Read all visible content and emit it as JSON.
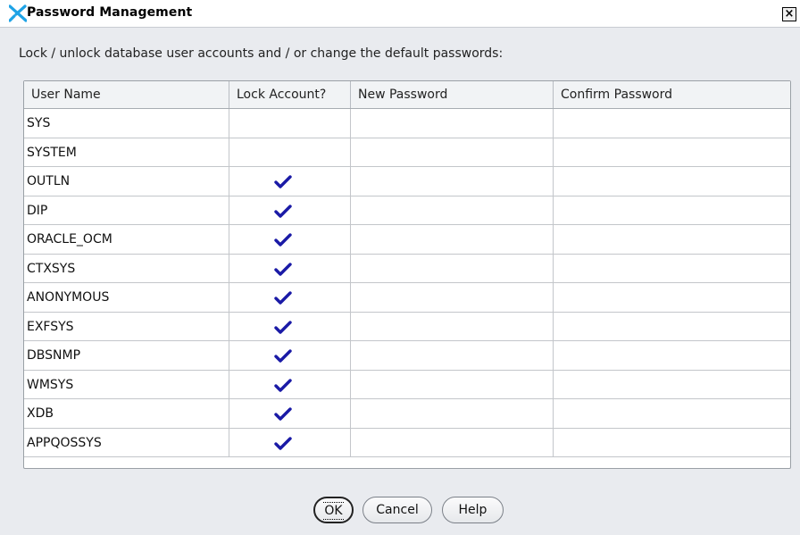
{
  "window": {
    "title": "Password Management",
    "close_symbol": "×",
    "icon": "oracle-x-icon"
  },
  "instructions": "Lock / unlock database user accounts and / or change the default passwords:",
  "table": {
    "columns": [
      "User Name",
      "Lock Account?",
      "New Password",
      "Confirm Password"
    ],
    "rows": [
      {
        "user": "SYS",
        "locked": false,
        "new_password": "",
        "confirm_password": ""
      },
      {
        "user": "SYSTEM",
        "locked": false,
        "new_password": "",
        "confirm_password": ""
      },
      {
        "user": "OUTLN",
        "locked": true,
        "new_password": "",
        "confirm_password": ""
      },
      {
        "user": "DIP",
        "locked": true,
        "new_password": "",
        "confirm_password": ""
      },
      {
        "user": "ORACLE_OCM",
        "locked": true,
        "new_password": "",
        "confirm_password": ""
      },
      {
        "user": "CTXSYS",
        "locked": true,
        "new_password": "",
        "confirm_password": ""
      },
      {
        "user": "ANONYMOUS",
        "locked": true,
        "new_password": "",
        "confirm_password": ""
      },
      {
        "user": "EXFSYS",
        "locked": true,
        "new_password": "",
        "confirm_password": ""
      },
      {
        "user": "DBSNMP",
        "locked": true,
        "new_password": "",
        "confirm_password": ""
      },
      {
        "user": "WMSYS",
        "locked": true,
        "new_password": "",
        "confirm_password": ""
      },
      {
        "user": "XDB",
        "locked": true,
        "new_password": "",
        "confirm_password": ""
      },
      {
        "user": "APPQOSSYS",
        "locked": true,
        "new_password": "",
        "confirm_password": ""
      }
    ]
  },
  "buttons": {
    "ok": "OK",
    "cancel": "Cancel",
    "help": "Help"
  },
  "colors": {
    "checkmark": "#1a1aa6",
    "dialog_background": "#e9ebef",
    "icon_accent": "#1ea3e6"
  }
}
